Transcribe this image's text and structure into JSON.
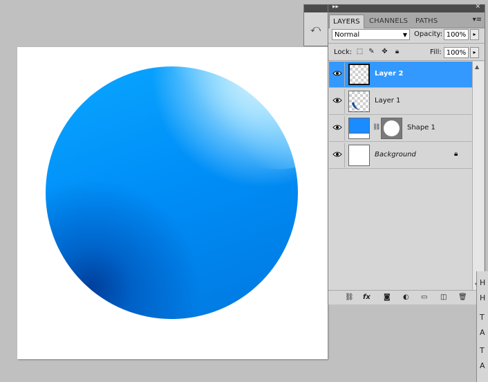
{
  "panel": {
    "tabs": [
      {
        "label": "LAYERS",
        "active": true
      },
      {
        "label": "CHANNELS",
        "active": false
      },
      {
        "label": "PATHS",
        "active": false
      }
    ],
    "blend_mode": "Normal",
    "opacity_label": "Opacity:",
    "opacity_value": "100%",
    "lock_label": "Lock:",
    "fill_label": "Fill:",
    "fill_value": "100%"
  },
  "layers": [
    {
      "name": "Layer 2",
      "selected": true
    },
    {
      "name": "Layer 1",
      "selected": false
    },
    {
      "name": "Shape 1",
      "selected": false
    },
    {
      "name": "Background",
      "selected": false,
      "locked": true
    }
  ],
  "colors": {
    "selection": "#3399ff",
    "sphere_blue": "#008ff8",
    "panel_bg": "#d6d6d6"
  },
  "right_strip": {
    "chars": [
      "H",
      "H",
      "T",
      "A",
      "T",
      "A"
    ]
  }
}
